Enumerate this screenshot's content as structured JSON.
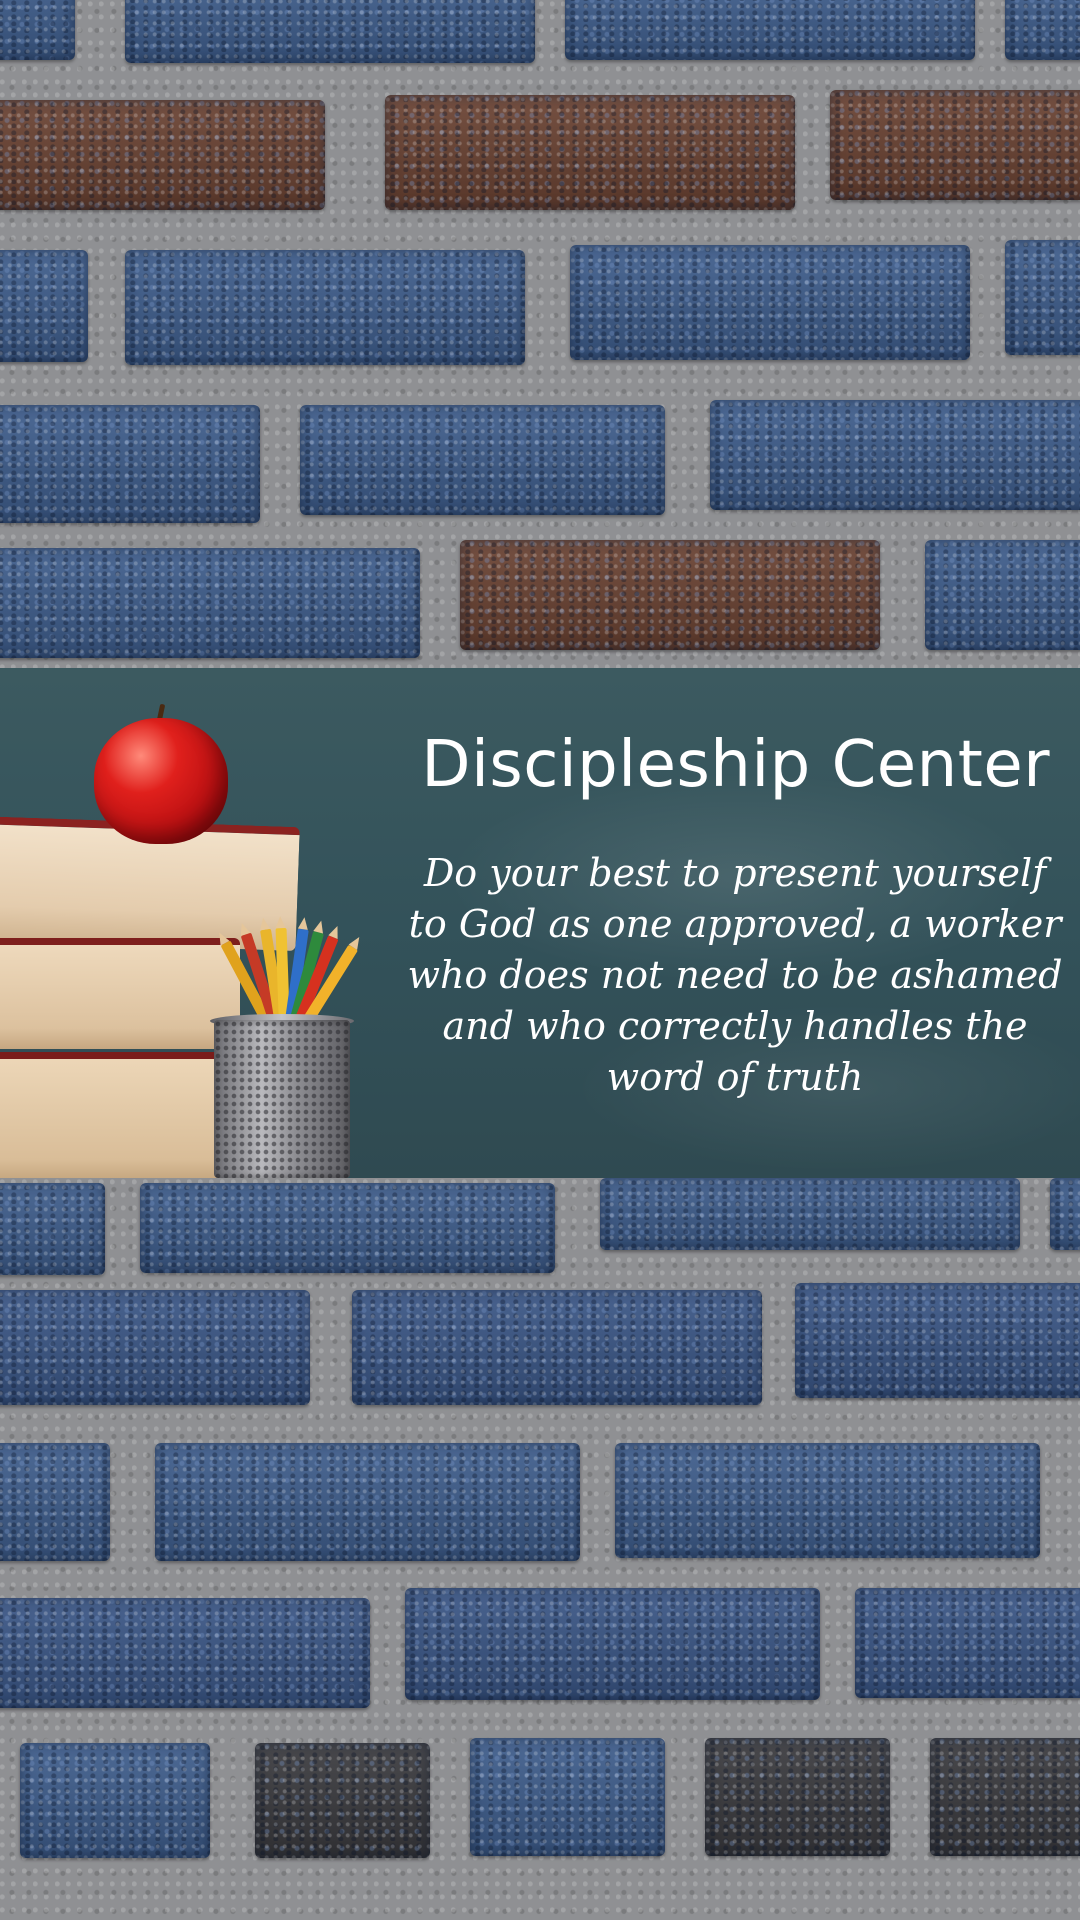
{
  "banner": {
    "title": "Discipleship Center",
    "verse": "Do your best to present yourself to God as one approved, a worker who does not need to be ashamed and who correctly handles the word of truth"
  },
  "colors": {
    "brick_blue": "#3e5d8c",
    "brick_brown": "#6a4232",
    "mortar": "#8f9093",
    "chalkboard": "#33525a",
    "text": "#ffffff",
    "apple": "#d41a18"
  },
  "illustration": {
    "items": [
      "apple-icon",
      "book-stack-icon",
      "pencil-cup-icon"
    ]
  }
}
